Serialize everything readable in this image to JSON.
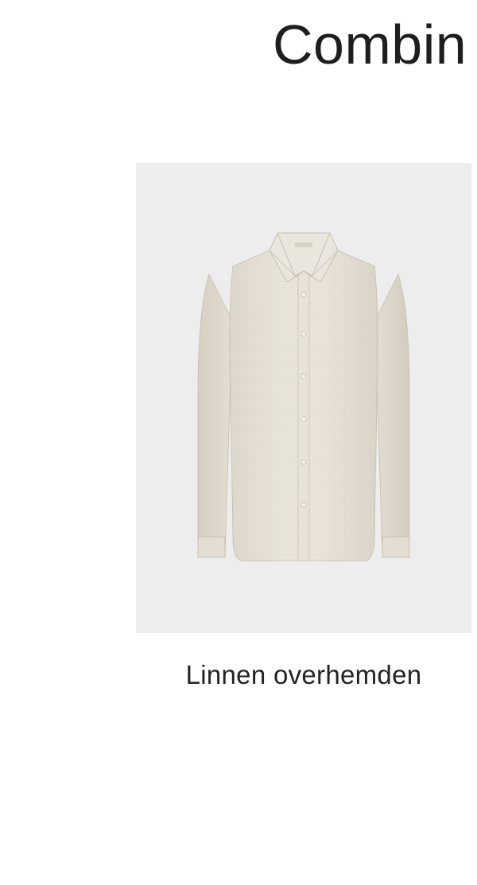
{
  "section": {
    "heading": "Combin"
  },
  "product": {
    "label": "Linnen overhemden",
    "image_icon": "linen-shirt-icon",
    "colors": {
      "image_background": "#ededed",
      "shirt_fabric": "#e6e0d6",
      "text": "#232323"
    }
  }
}
